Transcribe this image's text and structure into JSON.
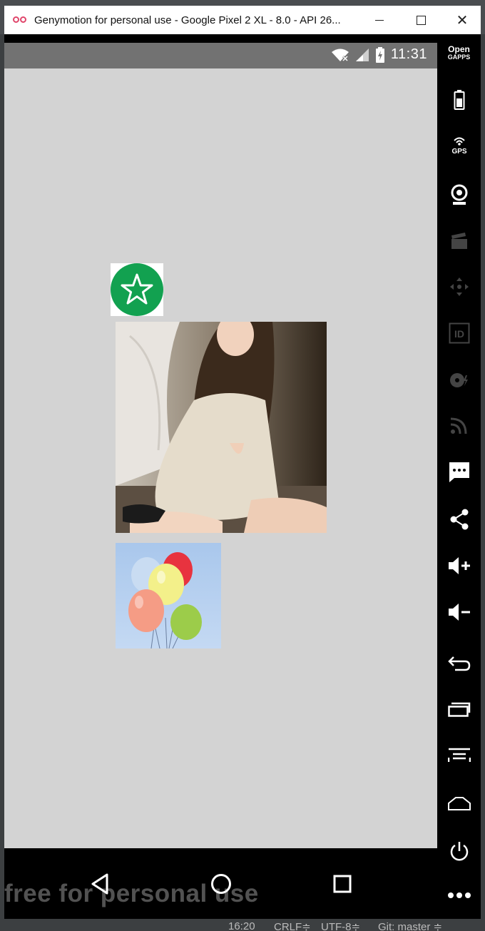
{
  "window": {
    "title": "Genymotion for personal use - Google Pixel 2 XL - 8.0 - API 26...",
    "minimize_icon": "minimize-icon",
    "maximize_icon": "maximize-icon",
    "close_label": "✕"
  },
  "statusbar": {
    "time": "11:31",
    "icons": [
      "wifi-off-icon",
      "signal-icon",
      "battery-charging-icon"
    ]
  },
  "screen": {
    "background": "#d3d3d3",
    "images": [
      "star-badge-image",
      "portrait-photo-image",
      "balloons-image"
    ]
  },
  "sidebar": {
    "opengapps_line1": "Open",
    "opengapps_line2": "GAPPS",
    "items": [
      "battery-icon",
      "gps-icon",
      "webcam-icon",
      "screencast-icon",
      "dpad-icon",
      "device-id-icon",
      "disk-io-icon",
      "network-icon",
      "sms-icon",
      "share-icon",
      "volume-up-icon",
      "volume-down-icon",
      "back-icon",
      "recent-apps-icon",
      "menu-icon",
      "home-icon",
      "power-icon",
      "more-icon"
    ],
    "gps_label": "GPS",
    "id_label": "ID"
  },
  "navbar": {
    "watermark": "free for personal use",
    "buttons": [
      "nav-back-icon",
      "nav-home-icon",
      "nav-recents-icon"
    ]
  },
  "ide_status": {
    "position": "16:20",
    "line_separator": "CRLF≑",
    "encoding": "UTF-8≑",
    "vcs": "Git: master ≑"
  }
}
